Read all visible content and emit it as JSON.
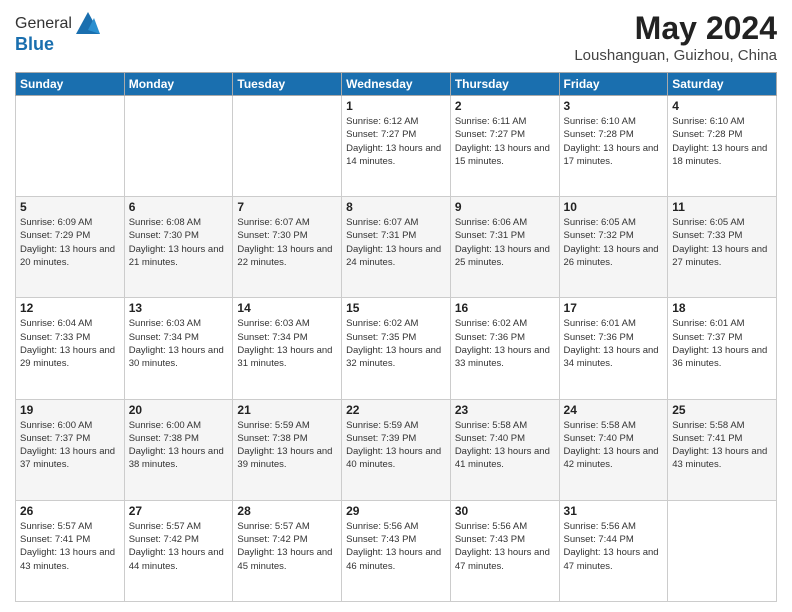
{
  "header": {
    "logo_general": "General",
    "logo_blue": "Blue",
    "main_title": "May 2024",
    "subtitle": "Loushanguan, Guizhou, China"
  },
  "weekdays": [
    "Sunday",
    "Monday",
    "Tuesday",
    "Wednesday",
    "Thursday",
    "Friday",
    "Saturday"
  ],
  "weeks": [
    [
      {
        "day": "",
        "sunrise": "",
        "sunset": "",
        "daylight": ""
      },
      {
        "day": "",
        "sunrise": "",
        "sunset": "",
        "daylight": ""
      },
      {
        "day": "",
        "sunrise": "",
        "sunset": "",
        "daylight": ""
      },
      {
        "day": "1",
        "sunrise": "Sunrise: 6:12 AM",
        "sunset": "Sunset: 7:27 PM",
        "daylight": "Daylight: 13 hours and 14 minutes."
      },
      {
        "day": "2",
        "sunrise": "Sunrise: 6:11 AM",
        "sunset": "Sunset: 7:27 PM",
        "daylight": "Daylight: 13 hours and 15 minutes."
      },
      {
        "day": "3",
        "sunrise": "Sunrise: 6:10 AM",
        "sunset": "Sunset: 7:28 PM",
        "daylight": "Daylight: 13 hours and 17 minutes."
      },
      {
        "day": "4",
        "sunrise": "Sunrise: 6:10 AM",
        "sunset": "Sunset: 7:28 PM",
        "daylight": "Daylight: 13 hours and 18 minutes."
      }
    ],
    [
      {
        "day": "5",
        "sunrise": "Sunrise: 6:09 AM",
        "sunset": "Sunset: 7:29 PM",
        "daylight": "Daylight: 13 hours and 20 minutes."
      },
      {
        "day": "6",
        "sunrise": "Sunrise: 6:08 AM",
        "sunset": "Sunset: 7:30 PM",
        "daylight": "Daylight: 13 hours and 21 minutes."
      },
      {
        "day": "7",
        "sunrise": "Sunrise: 6:07 AM",
        "sunset": "Sunset: 7:30 PM",
        "daylight": "Daylight: 13 hours and 22 minutes."
      },
      {
        "day": "8",
        "sunrise": "Sunrise: 6:07 AM",
        "sunset": "Sunset: 7:31 PM",
        "daylight": "Daylight: 13 hours and 24 minutes."
      },
      {
        "day": "9",
        "sunrise": "Sunrise: 6:06 AM",
        "sunset": "Sunset: 7:31 PM",
        "daylight": "Daylight: 13 hours and 25 minutes."
      },
      {
        "day": "10",
        "sunrise": "Sunrise: 6:05 AM",
        "sunset": "Sunset: 7:32 PM",
        "daylight": "Daylight: 13 hours and 26 minutes."
      },
      {
        "day": "11",
        "sunrise": "Sunrise: 6:05 AM",
        "sunset": "Sunset: 7:33 PM",
        "daylight": "Daylight: 13 hours and 27 minutes."
      }
    ],
    [
      {
        "day": "12",
        "sunrise": "Sunrise: 6:04 AM",
        "sunset": "Sunset: 7:33 PM",
        "daylight": "Daylight: 13 hours and 29 minutes."
      },
      {
        "day": "13",
        "sunrise": "Sunrise: 6:03 AM",
        "sunset": "Sunset: 7:34 PM",
        "daylight": "Daylight: 13 hours and 30 minutes."
      },
      {
        "day": "14",
        "sunrise": "Sunrise: 6:03 AM",
        "sunset": "Sunset: 7:34 PM",
        "daylight": "Daylight: 13 hours and 31 minutes."
      },
      {
        "day": "15",
        "sunrise": "Sunrise: 6:02 AM",
        "sunset": "Sunset: 7:35 PM",
        "daylight": "Daylight: 13 hours and 32 minutes."
      },
      {
        "day": "16",
        "sunrise": "Sunrise: 6:02 AM",
        "sunset": "Sunset: 7:36 PM",
        "daylight": "Daylight: 13 hours and 33 minutes."
      },
      {
        "day": "17",
        "sunrise": "Sunrise: 6:01 AM",
        "sunset": "Sunset: 7:36 PM",
        "daylight": "Daylight: 13 hours and 34 minutes."
      },
      {
        "day": "18",
        "sunrise": "Sunrise: 6:01 AM",
        "sunset": "Sunset: 7:37 PM",
        "daylight": "Daylight: 13 hours and 36 minutes."
      }
    ],
    [
      {
        "day": "19",
        "sunrise": "Sunrise: 6:00 AM",
        "sunset": "Sunset: 7:37 PM",
        "daylight": "Daylight: 13 hours and 37 minutes."
      },
      {
        "day": "20",
        "sunrise": "Sunrise: 6:00 AM",
        "sunset": "Sunset: 7:38 PM",
        "daylight": "Daylight: 13 hours and 38 minutes."
      },
      {
        "day": "21",
        "sunrise": "Sunrise: 5:59 AM",
        "sunset": "Sunset: 7:38 PM",
        "daylight": "Daylight: 13 hours and 39 minutes."
      },
      {
        "day": "22",
        "sunrise": "Sunrise: 5:59 AM",
        "sunset": "Sunset: 7:39 PM",
        "daylight": "Daylight: 13 hours and 40 minutes."
      },
      {
        "day": "23",
        "sunrise": "Sunrise: 5:58 AM",
        "sunset": "Sunset: 7:40 PM",
        "daylight": "Daylight: 13 hours and 41 minutes."
      },
      {
        "day": "24",
        "sunrise": "Sunrise: 5:58 AM",
        "sunset": "Sunset: 7:40 PM",
        "daylight": "Daylight: 13 hours and 42 minutes."
      },
      {
        "day": "25",
        "sunrise": "Sunrise: 5:58 AM",
        "sunset": "Sunset: 7:41 PM",
        "daylight": "Daylight: 13 hours and 43 minutes."
      }
    ],
    [
      {
        "day": "26",
        "sunrise": "Sunrise: 5:57 AM",
        "sunset": "Sunset: 7:41 PM",
        "daylight": "Daylight: 13 hours and 43 minutes."
      },
      {
        "day": "27",
        "sunrise": "Sunrise: 5:57 AM",
        "sunset": "Sunset: 7:42 PM",
        "daylight": "Daylight: 13 hours and 44 minutes."
      },
      {
        "day": "28",
        "sunrise": "Sunrise: 5:57 AM",
        "sunset": "Sunset: 7:42 PM",
        "daylight": "Daylight: 13 hours and 45 minutes."
      },
      {
        "day": "29",
        "sunrise": "Sunrise: 5:56 AM",
        "sunset": "Sunset: 7:43 PM",
        "daylight": "Daylight: 13 hours and 46 minutes."
      },
      {
        "day": "30",
        "sunrise": "Sunrise: 5:56 AM",
        "sunset": "Sunset: 7:43 PM",
        "daylight": "Daylight: 13 hours and 47 minutes."
      },
      {
        "day": "31",
        "sunrise": "Sunrise: 5:56 AM",
        "sunset": "Sunset: 7:44 PM",
        "daylight": "Daylight: 13 hours and 47 minutes."
      },
      {
        "day": "",
        "sunrise": "",
        "sunset": "",
        "daylight": ""
      }
    ]
  ]
}
